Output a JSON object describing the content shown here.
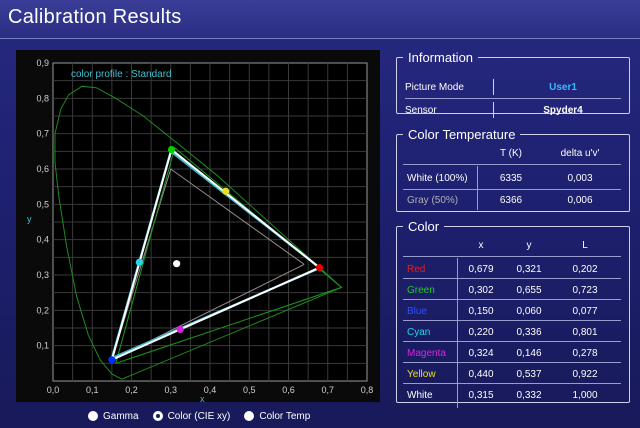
{
  "window": {
    "title": "Calibration Results"
  },
  "chart": {
    "profile_label": "color profile :  Standard",
    "x_axis_label": "x",
    "y_axis_label": "y",
    "x_ticks": [
      "0,0",
      "0,1",
      "0,2",
      "0,3",
      "0,4",
      "0,5",
      "0,6",
      "0,7",
      "0,8"
    ],
    "y_ticks": [
      "0,1",
      "0,2",
      "0,3",
      "0,4",
      "0,5",
      "0,6",
      "0,7",
      "0,8",
      "0,9"
    ],
    "colors": {
      "grid": "#3a3a3a",
      "locus": "#1f8a1f",
      "measured": "#ffffff",
      "target": "#40b8c8",
      "reference": "#1a9a1a",
      "standard": "#9a8a90"
    }
  },
  "chart_data": {
    "type": "scatter",
    "title": "",
    "xlabel": "x",
    "ylabel": "y",
    "xlim": [
      0,
      0.8
    ],
    "ylim": [
      0,
      0.9
    ],
    "grid": true,
    "points": [
      {
        "name": "Red",
        "x": 0.679,
        "y": 0.321,
        "color": "#e00000"
      },
      {
        "name": "Green",
        "x": 0.302,
        "y": 0.655,
        "color": "#00d000"
      },
      {
        "name": "Blue",
        "x": 0.15,
        "y": 0.06,
        "color": "#0030ff"
      },
      {
        "name": "Cyan",
        "x": 0.22,
        "y": 0.336,
        "color": "#20d8e8"
      },
      {
        "name": "Magenta",
        "x": 0.324,
        "y": 0.146,
        "color": "#e020e0"
      },
      {
        "name": "Yellow",
        "x": 0.44,
        "y": 0.537,
        "color": "#e8e020"
      },
      {
        "name": "White",
        "x": 0.315,
        "y": 0.332,
        "color": "#ffffff"
      }
    ],
    "target_triangle": [
      [
        0.68,
        0.32
      ],
      [
        0.3,
        0.65
      ],
      [
        0.15,
        0.065
      ]
    ],
    "reference_triangle": [
      [
        0.735,
        0.265
      ],
      [
        0.31,
        0.66
      ],
      [
        0.16,
        0.05
      ]
    ],
    "standard_triangle": [
      [
        0.64,
        0.33
      ],
      [
        0.3,
        0.6
      ],
      [
        0.15,
        0.06
      ]
    ]
  },
  "view_options": [
    {
      "label": "Gamma",
      "selected": false
    },
    {
      "label": "Color (CIE xy)",
      "selected": true
    },
    {
      "label": "Color Temp",
      "selected": false
    }
  ],
  "information": {
    "legend": "Information",
    "rows": [
      {
        "label": "Picture Mode",
        "value": "User1",
        "value_color": "#38b8ff"
      },
      {
        "label": "Sensor",
        "value": "Spyder4",
        "value_color": "#ffffff"
      }
    ]
  },
  "color_temperature": {
    "legend": "Color Temperature",
    "headers": [
      "T (K)",
      "delta u'v'"
    ],
    "rows": [
      {
        "label": "White (100%)",
        "label_color": "#ffffff",
        "t": "6335",
        "delta": "0,003"
      },
      {
        "label": "Gray (50%)",
        "label_color": "#b0b0b8",
        "t": "6366",
        "delta": "0,006"
      }
    ]
  },
  "color": {
    "legend": "Color",
    "headers": [
      "x",
      "y",
      "L"
    ],
    "rows": [
      {
        "name": "Red",
        "color": "#e02020",
        "x": "0,679",
        "y": "0,321",
        "L": "0,202"
      },
      {
        "name": "Green",
        "color": "#20d020",
        "x": "0,302",
        "y": "0,655",
        "L": "0,723"
      },
      {
        "name": "Blue",
        "color": "#3050ff",
        "x": "0,150",
        "y": "0,060",
        "L": "0,077"
      },
      {
        "name": "Cyan",
        "color": "#20d8e8",
        "x": "0,220",
        "y": "0,336",
        "L": "0,801"
      },
      {
        "name": "Magenta",
        "color": "#e020e0",
        "x": "0,324",
        "y": "0,146",
        "L": "0,278"
      },
      {
        "name": "Yellow",
        "color": "#e8e020",
        "x": "0,440",
        "y": "0,537",
        "L": "0,922"
      },
      {
        "name": "White",
        "color": "#ffffff",
        "x": "0,315",
        "y": "0,332",
        "L": "1,000"
      }
    ]
  }
}
